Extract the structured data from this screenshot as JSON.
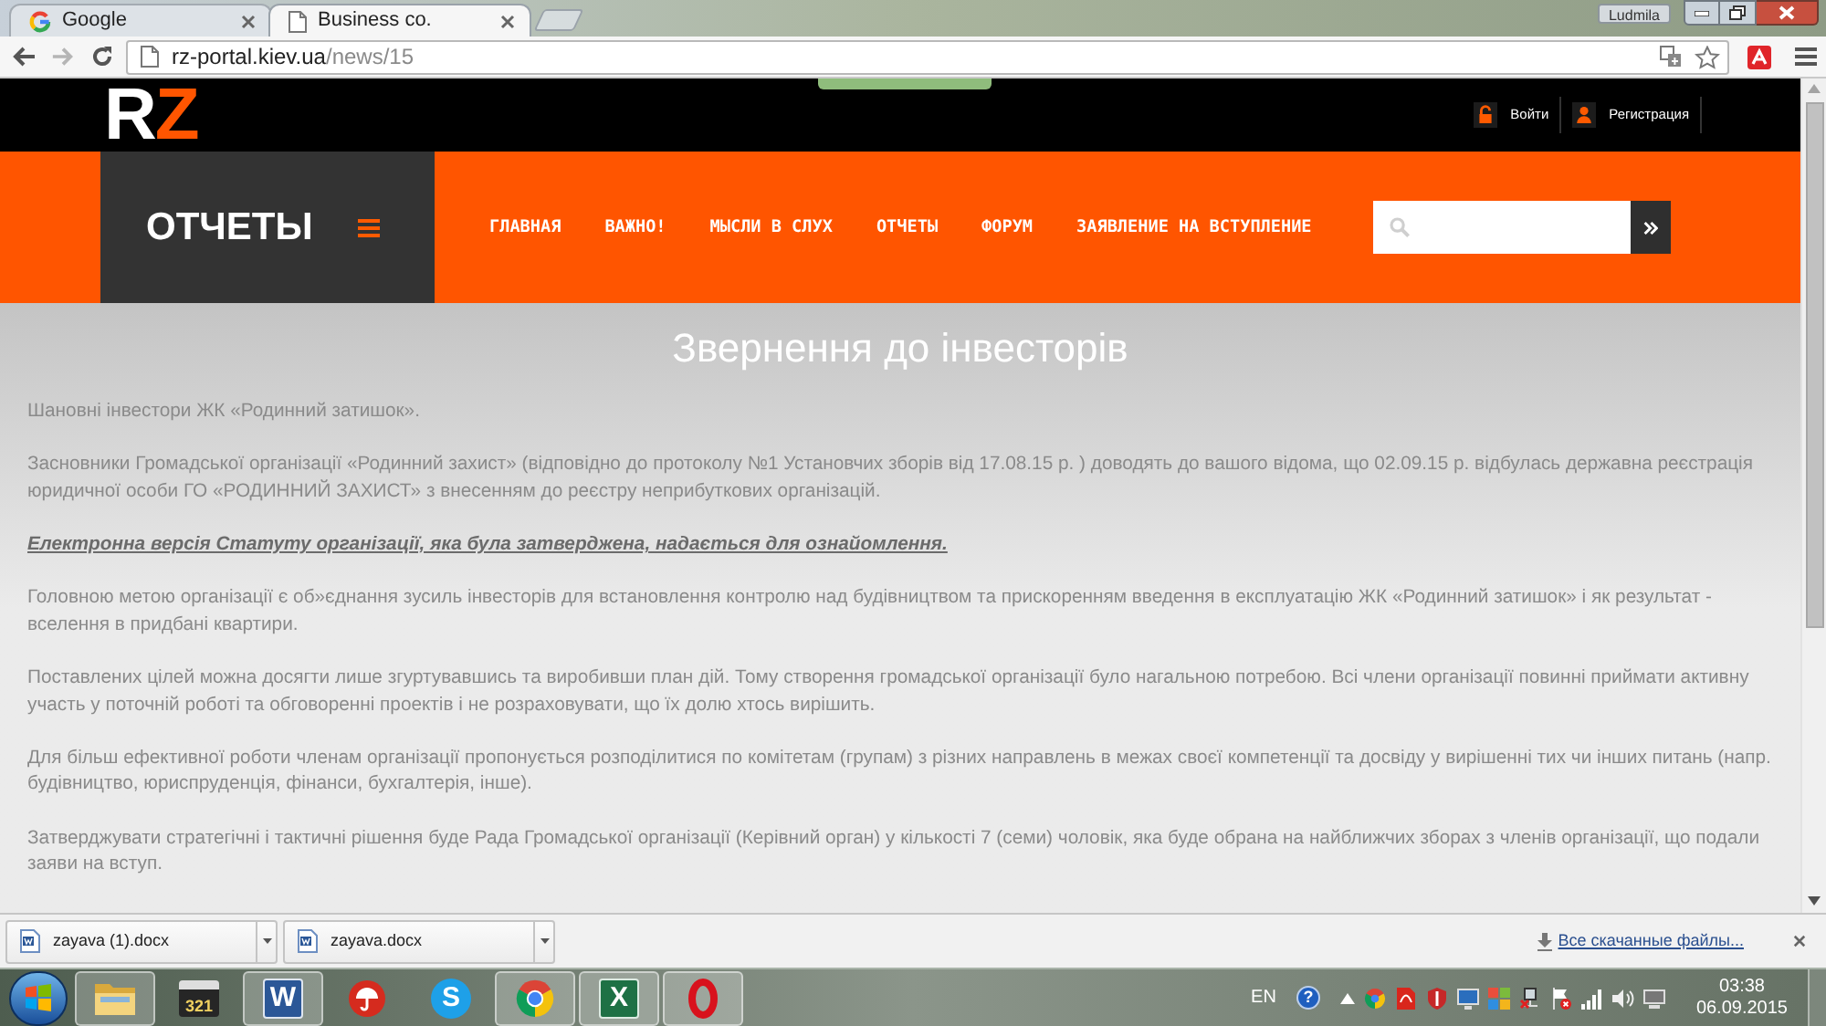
{
  "browser": {
    "tabs": [
      {
        "kind": "search",
        "title": "Google",
        "selected": false
      },
      {
        "kind": "document",
        "title": "Business co.",
        "selected": true
      }
    ],
    "profile": "Ludmila",
    "url": {
      "host": "rz-portal.kiev.ua",
      "path": "/news/15"
    }
  },
  "site_header": {
    "logo": [
      {
        "text": "R",
        "color": "#ffffff"
      },
      {
        "text": "Z",
        "color": "#ff5500"
      }
    ],
    "account_links": [
      {
        "kind": "login",
        "label": "Войти"
      },
      {
        "kind": "register",
        "label": "Регистрация"
      }
    ]
  },
  "nav": {
    "section_title": "ОТЧЕТЫ",
    "items": [
      "ГЛАВНАЯ",
      "ВАЖНО!",
      "МЫСЛИ В СЛУХ",
      "ОТЧЕТЫ",
      "ФОРУМ",
      "ЗАЯВЛЕНИЕ НА ВСТУПЛЕНИЕ"
    ]
  },
  "article": {
    "title": "Звернення до інвесторів",
    "paragraphs": [
      {
        "kind": "text",
        "text": "Шановні інвестори ЖК «Родинний затишок»."
      },
      {
        "kind": "text",
        "text": "Засновники Громадської організації «Родинний захист» (відповідно до протоколу №1 Установчих зборів від 17.08.15 р. ) доводять до вашого відома, що 02.09.15 р. відбулась державна реєстрація юридичної особи ГО «РОДИННИЙ ЗАХИСТ» з внесенням до реєстру неприбуткових організацій."
      },
      {
        "kind": "link",
        "text": "Електронна версія Статуту організації, яка була затверджена, надається для ознайомлення."
      },
      {
        "kind": "text",
        "text": "Головною метою організації є об»єднання зусиль інвесторів для встановлення контролю над будівництвом та прискоренням введення в експлуатацію ЖК «Родинний затишок» і як результат - вселення в придбані квартири."
      },
      {
        "kind": "text",
        "text": "Поставлених цілей можна досягти лише згуртувавшись та виробивши план дій. Тому створення громадської організації було нагальною потребою. Всі члени організації повинні приймати активну участь у поточній роботі та обговоренні проектів і не розраховувати, що їх долю хтось вирішить."
      },
      {
        "kind": "text",
        "text": "Для більш ефективної роботи членам організації пропонується розподілитися по комітетам (групам) з різних направлень в межах своєї компетенції та досвіду у вирішенні тих чи інших питань (напр. будівництво, юриспруденція, фінанси, бухгалтерія, інше)."
      },
      {
        "kind": "text",
        "text": "Затверджувати стратегічні і тактичні рішення буде Рада Громадської організації (Керівний орган) у кількості 7 (семи) чоловік, яка буде обрана на найближчих зборах з членів організації, що подали заяви на вступ."
      }
    ]
  },
  "downloads": {
    "files": [
      "zayava (1).docx",
      "zayava.docx"
    ],
    "show_all": "Все скачанные файлы..."
  },
  "taskbar": {
    "apps": [
      {
        "kind": "explorer",
        "running": true
      },
      {
        "kind": "media",
        "label": "321",
        "running": false
      },
      {
        "kind": "word",
        "label": "W",
        "running": true
      },
      {
        "kind": "antivirus",
        "running": false
      },
      {
        "kind": "skype",
        "label": "S",
        "running": false
      },
      {
        "kind": "browser",
        "running": true
      },
      {
        "kind": "excel",
        "label": "X",
        "running": true
      },
      {
        "kind": "opera",
        "running": true
      }
    ],
    "language": "EN",
    "help": "?",
    "time": "03:38",
    "date": "06.09.2015"
  }
}
